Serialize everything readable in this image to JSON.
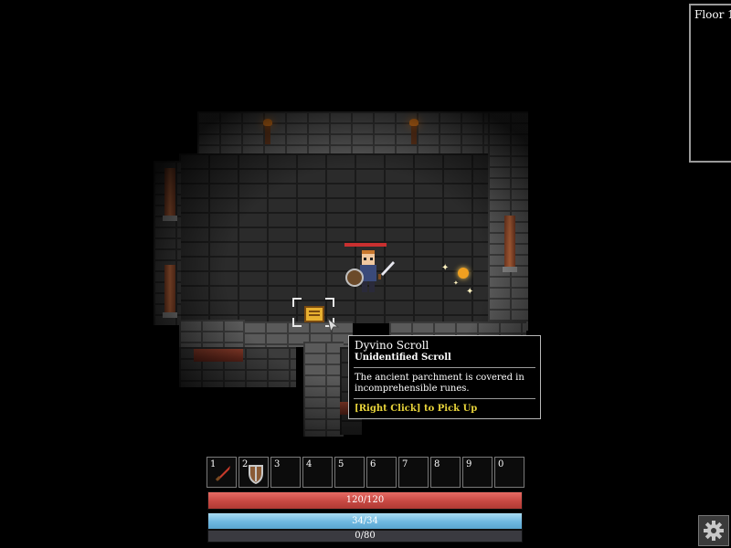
{
  "minimap": {
    "title": "Floor 1"
  },
  "tooltip": {
    "name": "Dyvino Scroll",
    "subtitle": "Unidentified Scroll",
    "description_line1": "The ancient parchment is covered in",
    "description_line2": "incomprehensible runes.",
    "action": "[Right Click] to Pick Up"
  },
  "hotbar": {
    "slots": [
      {
        "key": "1",
        "icon": "sword-icon"
      },
      {
        "key": "2",
        "icon": "shield-icon"
      },
      {
        "key": "3",
        "icon": ""
      },
      {
        "key": "4",
        "icon": ""
      },
      {
        "key": "5",
        "icon": ""
      },
      {
        "key": "6",
        "icon": ""
      },
      {
        "key": "7",
        "icon": ""
      },
      {
        "key": "8",
        "icon": ""
      },
      {
        "key": "9",
        "icon": ""
      },
      {
        "key": "0",
        "icon": ""
      }
    ]
  },
  "stats": {
    "health_text": "120/120",
    "mana_text": "34/34",
    "xp_text": "0/80",
    "health_color": "#c74842",
    "mana_color": "#6fb8e0"
  },
  "icons": {
    "settings": "gear-icon",
    "hero": "hero-sprite",
    "item": "scroll-icon"
  }
}
